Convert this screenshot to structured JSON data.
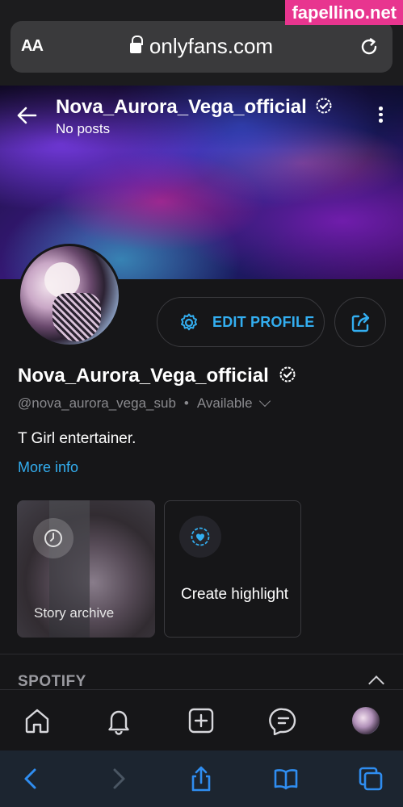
{
  "browser": {
    "aa_label": "AA",
    "url": "onlyfans.com"
  },
  "watermark": "fapellino.net",
  "cover": {
    "name": "Nova_Aurora_Vega_official",
    "posts_status": "No posts"
  },
  "profile": {
    "edit_button_label": "EDIT PROFILE",
    "display_name": "Nova_Aurora_Vega_official",
    "handle": "@nova_aurora_vega_sub",
    "separator": "•",
    "availability": "Available",
    "bio": "T Girl entertainer.",
    "more_info_label": "More info"
  },
  "highlights": {
    "story_archive_label": "Story archive",
    "create_highlight_label": "Create highlight"
  },
  "sections": {
    "spotify_title": "SPOTIFY"
  },
  "app_nav": {
    "items": [
      "home-icon",
      "bell-icon",
      "add-post-icon",
      "messages-icon",
      "profile-avatar"
    ]
  },
  "safari_nav": {
    "items": [
      "back-icon",
      "forward-icon",
      "share-icon",
      "bookmarks-icon",
      "tabs-icon"
    ]
  },
  "colors": {
    "accent": "#33aef0",
    "background": "#161618",
    "watermark": "#e8358f"
  }
}
